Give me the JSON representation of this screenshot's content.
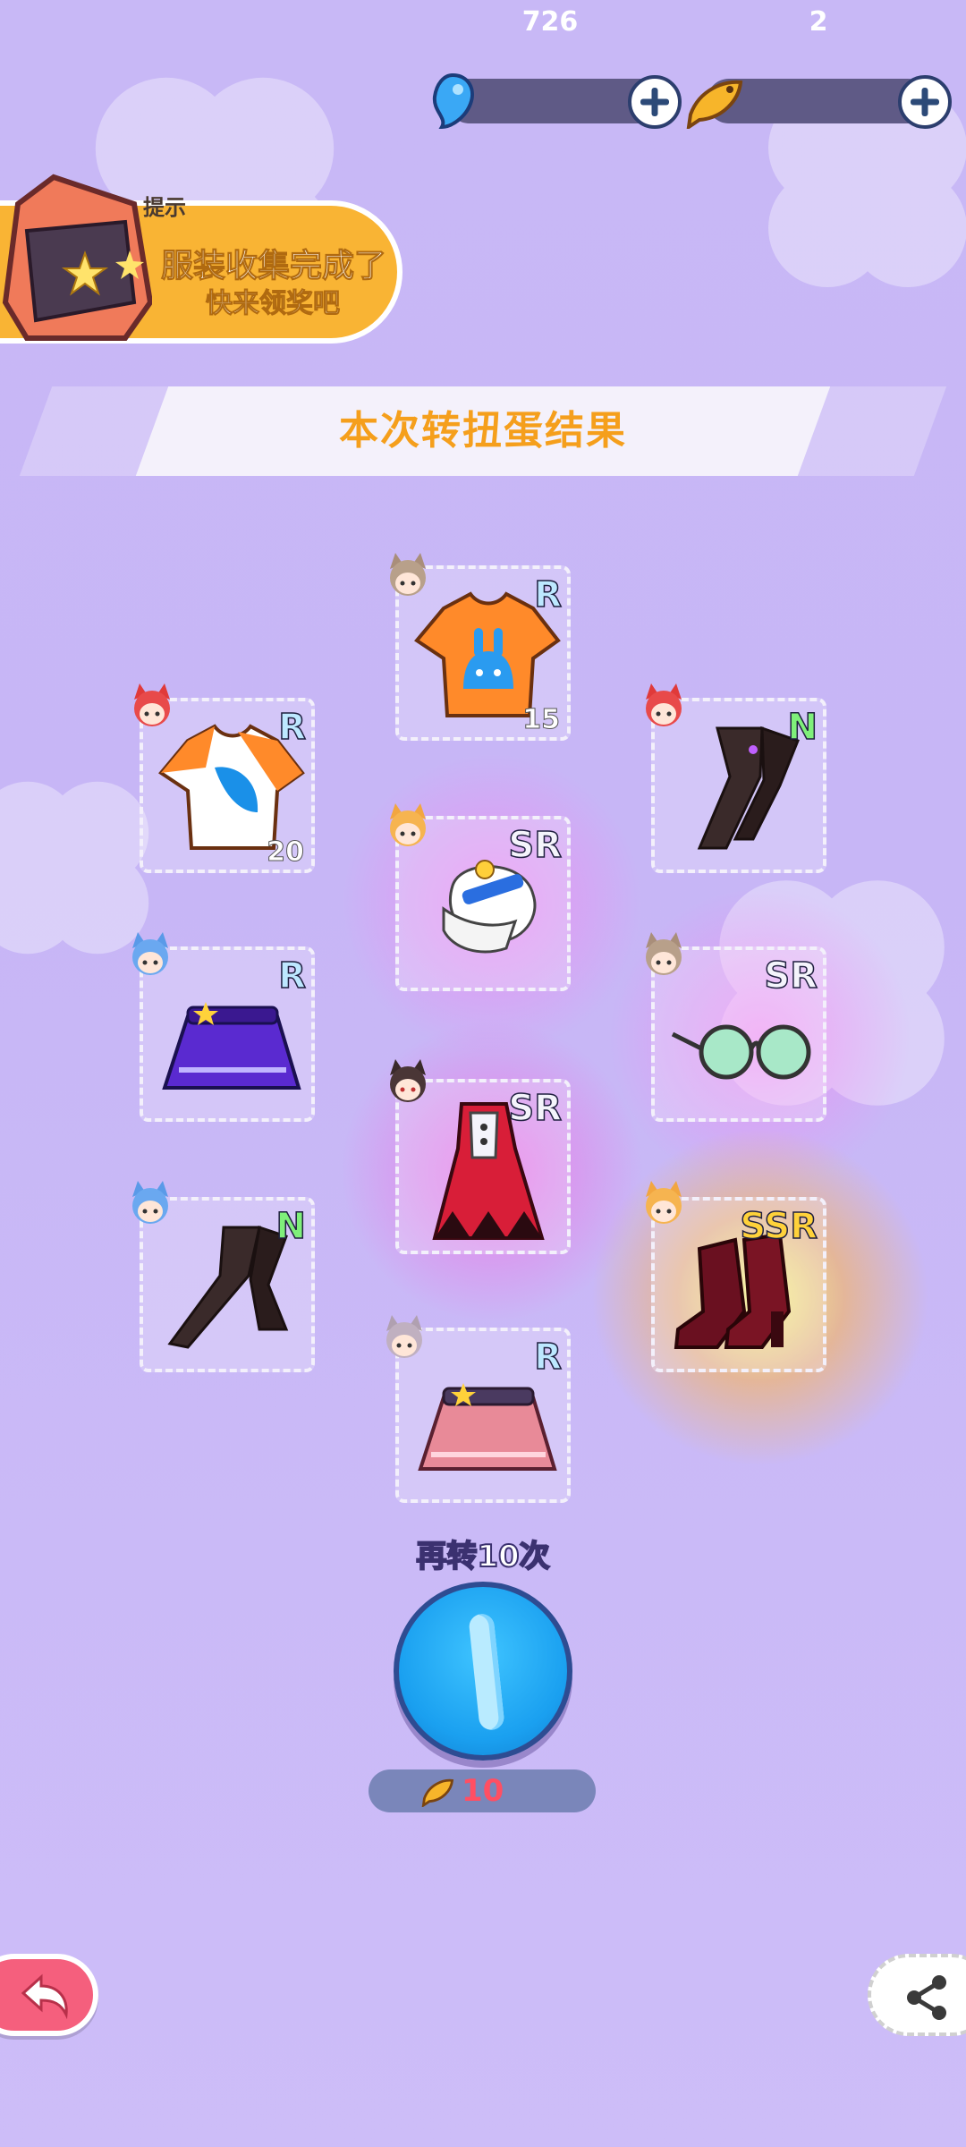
{
  "currency": {
    "gems": "726",
    "fish": "2"
  },
  "notice": {
    "tag": "提示",
    "line1": "服装收集完成了",
    "line2": "快来领奖吧"
  },
  "title": "本次转扭蛋结果",
  "cards": [
    {
      "rarity": "R",
      "item": "orange-bunny-shirt",
      "count": "15"
    },
    {
      "rarity": "R",
      "item": "orange-blue-shirt",
      "count": "20"
    },
    {
      "rarity": "N",
      "item": "black-tights",
      "count": ""
    },
    {
      "rarity": "SR",
      "item": "white-ruffle-headpiece",
      "count": ""
    },
    {
      "rarity": "R",
      "item": "purple-skirt",
      "count": ""
    },
    {
      "rarity": "SR",
      "item": "round-glasses",
      "count": ""
    },
    {
      "rarity": "SR",
      "item": "red-dress",
      "count": ""
    },
    {
      "rarity": "N",
      "item": "black-tights",
      "count": ""
    },
    {
      "rarity": "SSR",
      "item": "red-boots",
      "count": ""
    },
    {
      "rarity": "R",
      "item": "pink-skirt",
      "count": ""
    }
  ],
  "spin": {
    "label": "再转10次",
    "cost": "10"
  },
  "colors": {
    "background": "#c8b8f6",
    "accent_orange": "#f59f1c",
    "spin_blue": "#1aa0f0",
    "cost_red": "#ff4f63"
  },
  "icons": [
    "gem-icon",
    "fish-icon",
    "plus-icon",
    "back-arrow-icon",
    "share-icon",
    "fish-coin-icon"
  ]
}
